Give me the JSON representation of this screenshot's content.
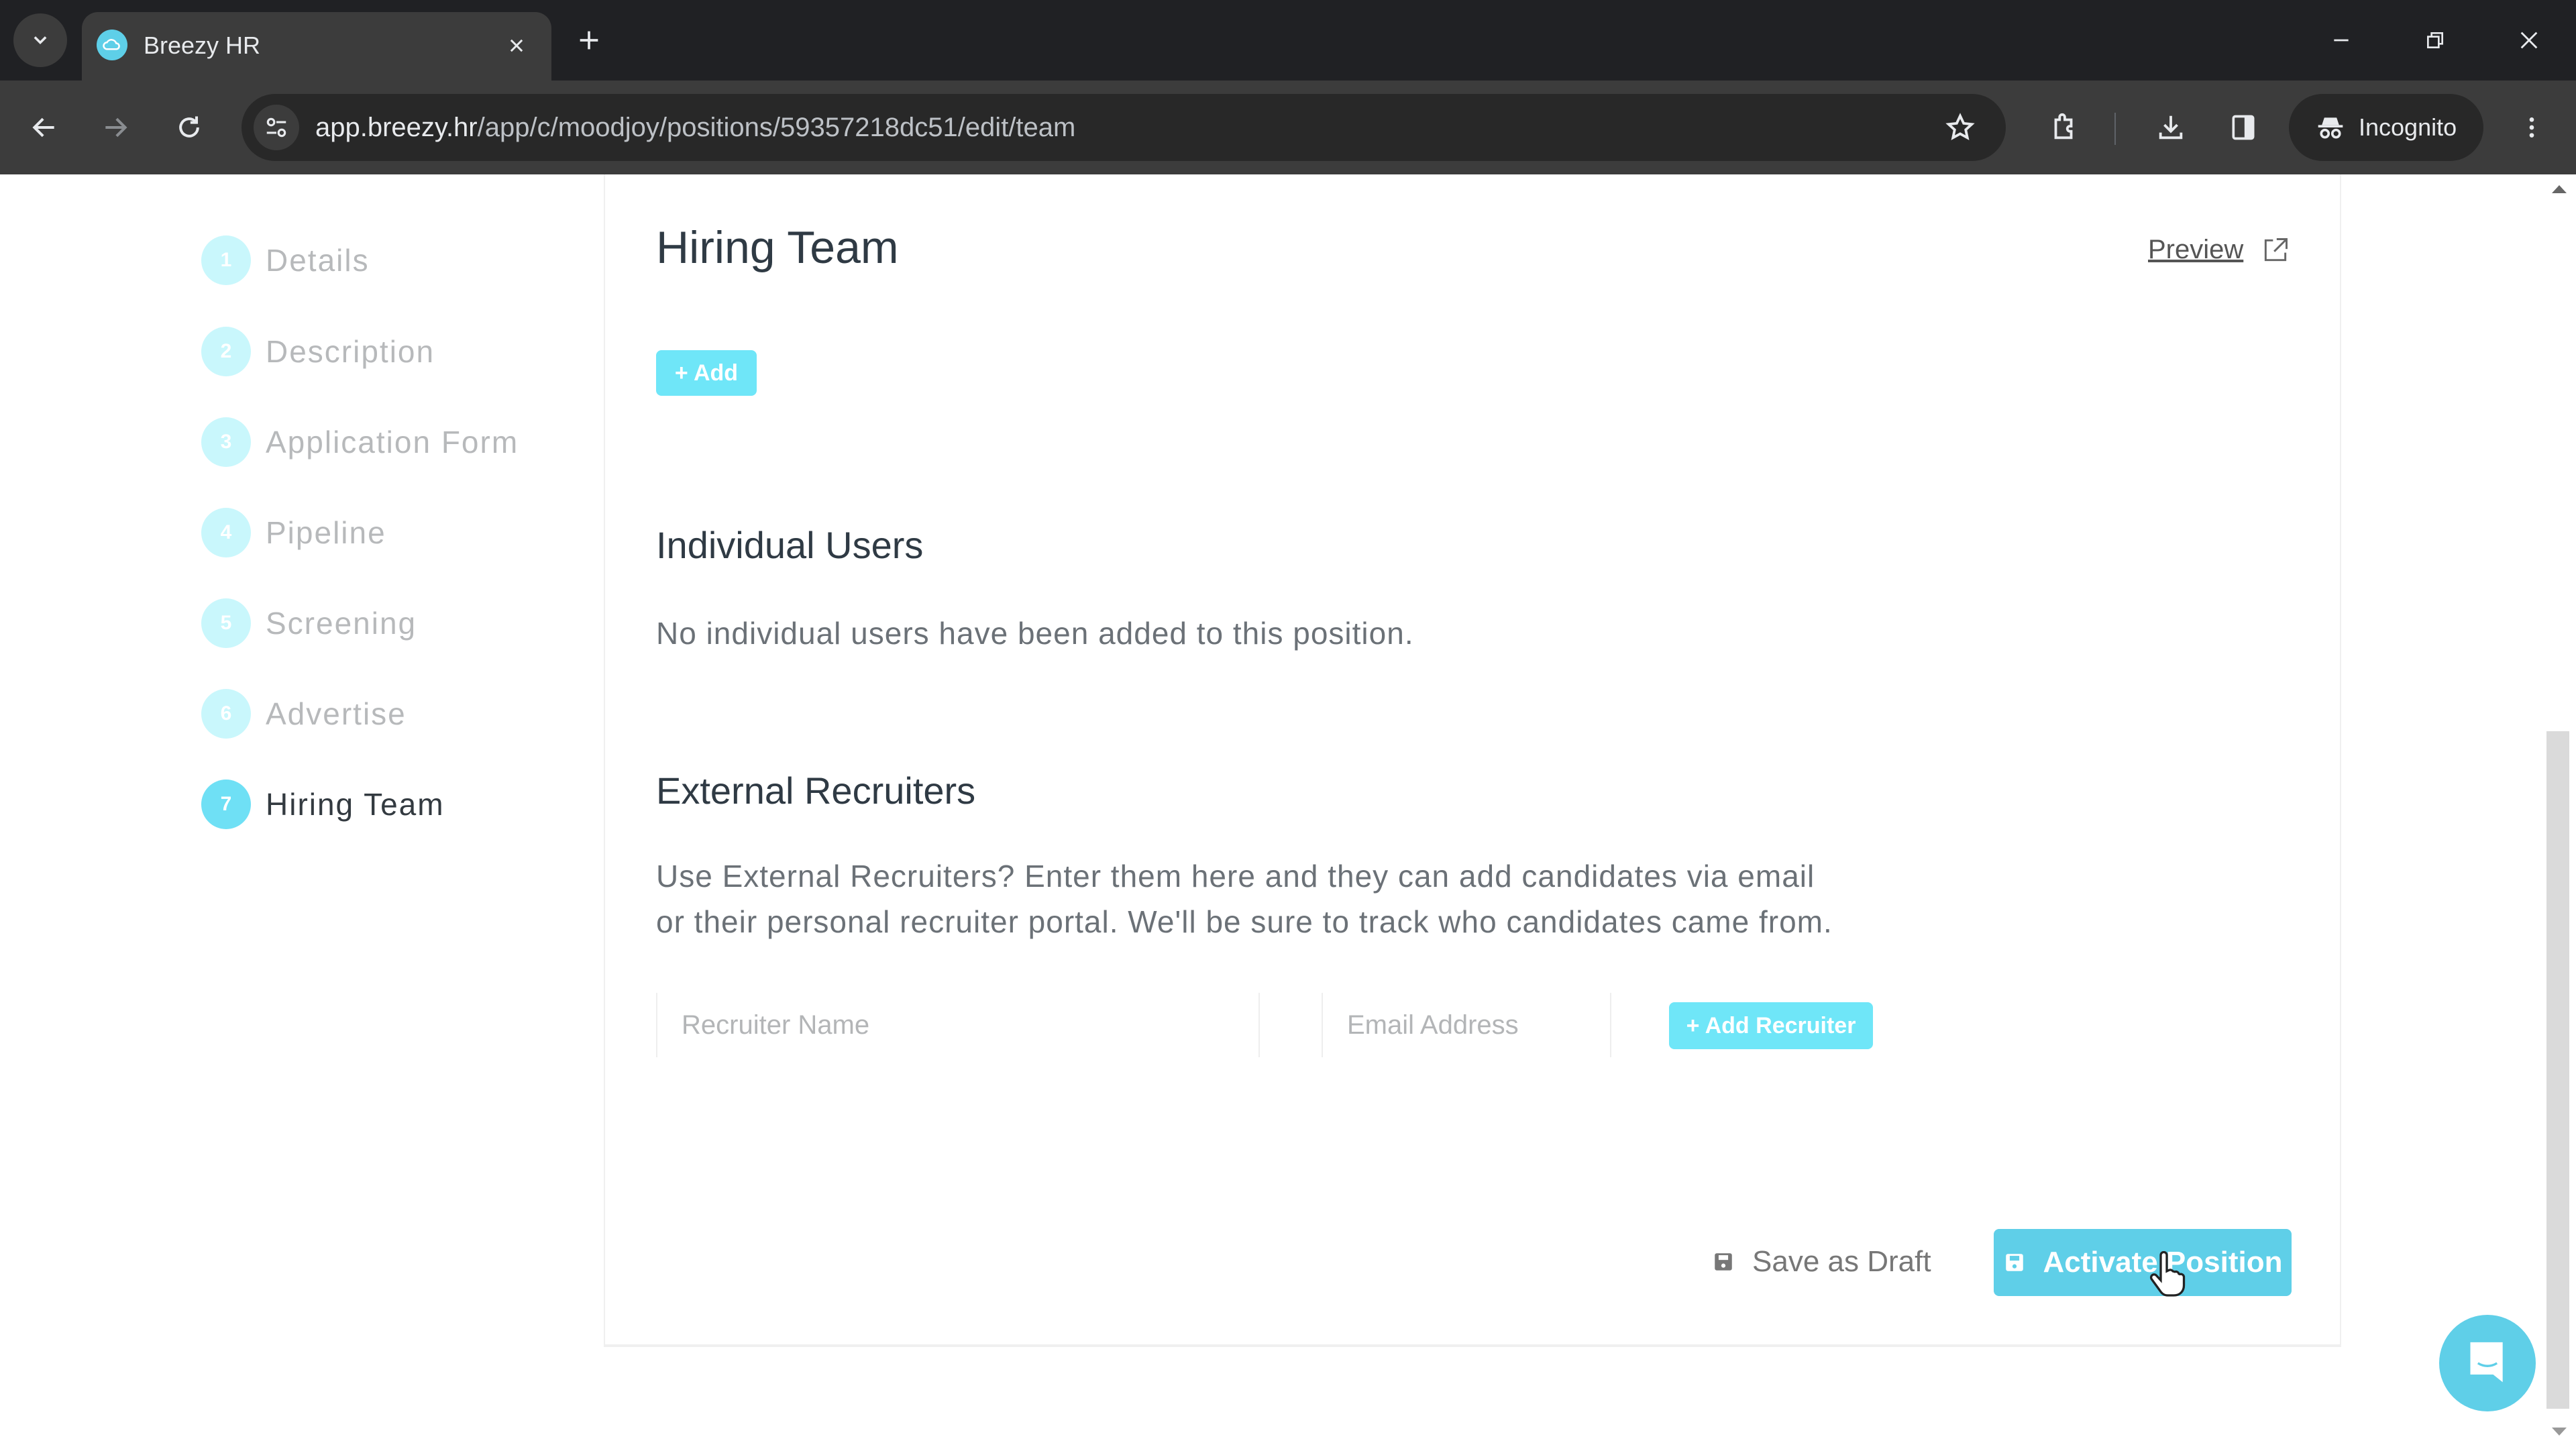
{
  "browser": {
    "tab": {
      "title": "Breezy HR",
      "favicon": "breezy-cloud-icon"
    },
    "url": {
      "host": "app.breezy.hr",
      "path": "/app/c/moodjoy/positions/59357218dc51/edit/team"
    },
    "incognito_label": "Incognito",
    "icons": [
      "tab-search-icon",
      "close-icon",
      "plus-icon",
      "minimize-icon",
      "restore-icon",
      "close-window-icon",
      "back-icon",
      "forward-icon",
      "reload-icon",
      "site-info-icon",
      "star-icon",
      "extensions-icon",
      "download-icon",
      "side-panel-icon",
      "incognito-icon",
      "more-menu-icon"
    ]
  },
  "steps": [
    {
      "number": "1",
      "label": "Details",
      "active": false
    },
    {
      "number": "2",
      "label": "Description",
      "active": false
    },
    {
      "number": "3",
      "label": "Application Form",
      "active": false
    },
    {
      "number": "4",
      "label": "Pipeline",
      "active": false
    },
    {
      "number": "5",
      "label": "Screening",
      "active": false
    },
    {
      "number": "6",
      "label": "Advertise",
      "active": false
    },
    {
      "number": "7",
      "label": "Hiring Team",
      "active": true
    }
  ],
  "main": {
    "title": "Hiring Team",
    "preview_label": "Preview",
    "add_button": "+ Add",
    "individual_users": {
      "title": "Individual Users",
      "empty_text": "No individual users have been added to this position."
    },
    "external_recruiters": {
      "title": "External Recruiters",
      "description_line1": "Use External Recruiters? Enter them here and they can add candidates via email",
      "description_line2": "or their personal recruiter portal. We'll be sure to track who candidates came from.",
      "name_placeholder": "Recruiter Name",
      "name_value": "",
      "email_placeholder": "Email Address",
      "email_value": "",
      "add_recruiter_button": "+ Add Recruiter"
    },
    "save_draft_label": "Save as Draft",
    "activate_label": "Activate Position"
  },
  "colors": {
    "accent": "#5fcfe8",
    "accent_light": "#6fe6f8",
    "step_inactive": "#c9f7fc",
    "text_dark": "#2f3a44",
    "chrome_dark": "#202124"
  }
}
